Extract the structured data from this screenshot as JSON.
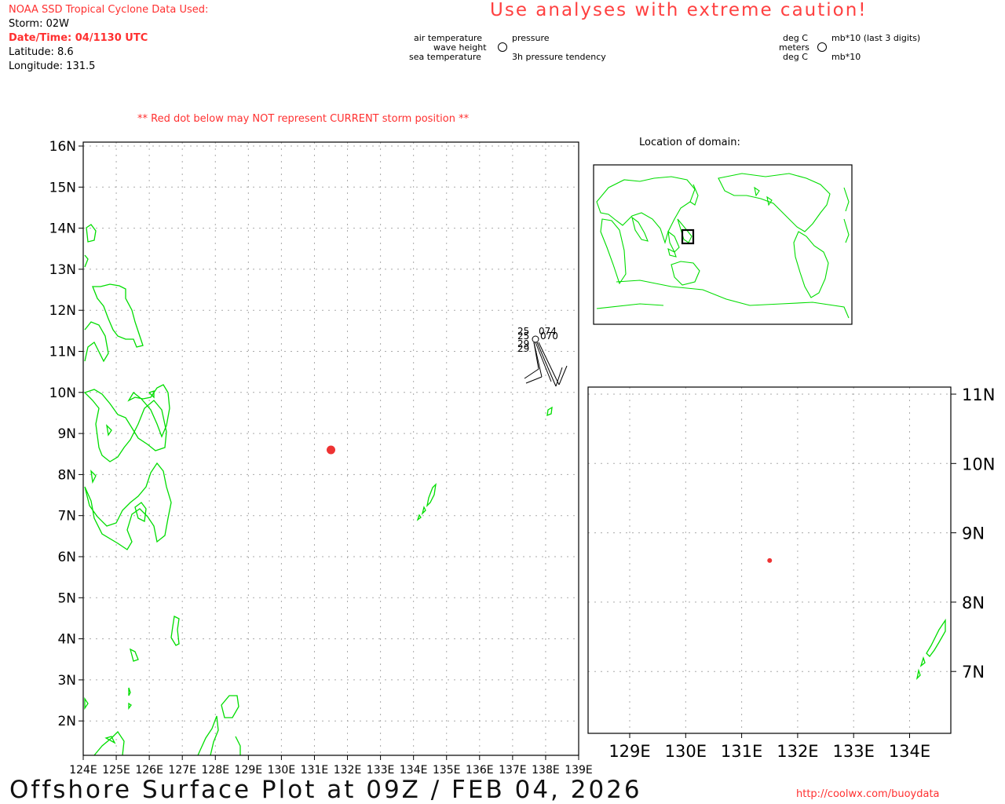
{
  "header": {
    "source": "NOAA SSD Tropical Cyclone Data Used:",
    "storm": "Storm: 02W",
    "datetime": "Date/Time: 04/1130 UTC",
    "latitude": "Latitude: 8.6",
    "longitude": "Longitude: 131.5",
    "warning": "Use analyses with extreme caution!"
  },
  "legend": {
    "air_temperature": "air temperature",
    "wave_height": "wave height",
    "sea_temperature": "sea temperature",
    "pressure": "pressure",
    "pressure_tendency": "3h pressure tendency",
    "deg_c_top": "deg C",
    "meters": "meters",
    "deg_c_bottom": "deg C",
    "mb_last3": "mb*10 (last 3 digits)",
    "mb10": "mb*10"
  },
  "notice": "** Red dot below may NOT represent CURRENT storm position **",
  "main_map": {
    "lon_labels": [
      "124E",
      "125E",
      "126E",
      "127E",
      "128E",
      "129E",
      "130E",
      "131E",
      "132E",
      "133E",
      "134E",
      "135E",
      "136E",
      "137E",
      "138E",
      "139E"
    ],
    "lat_labels": [
      "16N",
      "15N",
      "14N",
      "13N",
      "12N",
      "11N",
      "10N",
      "9N",
      "8N",
      "7N",
      "6N",
      "5N",
      "4N",
      "3N",
      "2N"
    ],
    "storm_position": {
      "lon": 131.5,
      "lat": 8.6
    },
    "station_values": [
      "25",
      "074",
      "25",
      "070",
      "29",
      "29"
    ]
  },
  "inset_map": {
    "title": "Location of domain:",
    "lon_labels": [
      "129E",
      "130E",
      "131E",
      "132E",
      "133E",
      "134E"
    ],
    "lat_labels": [
      "11N",
      "10N",
      "9N",
      "8N",
      "7N"
    ]
  },
  "colors": {
    "coast": "#00dd00",
    "storm": "#ee3333",
    "warning": "#ff4040",
    "grid": "#aaaaaa"
  },
  "footer": {
    "title": "Offshore Surface Plot at 09Z / FEB 04, 2026",
    "url": "http://coolwx.com/buoydata"
  }
}
